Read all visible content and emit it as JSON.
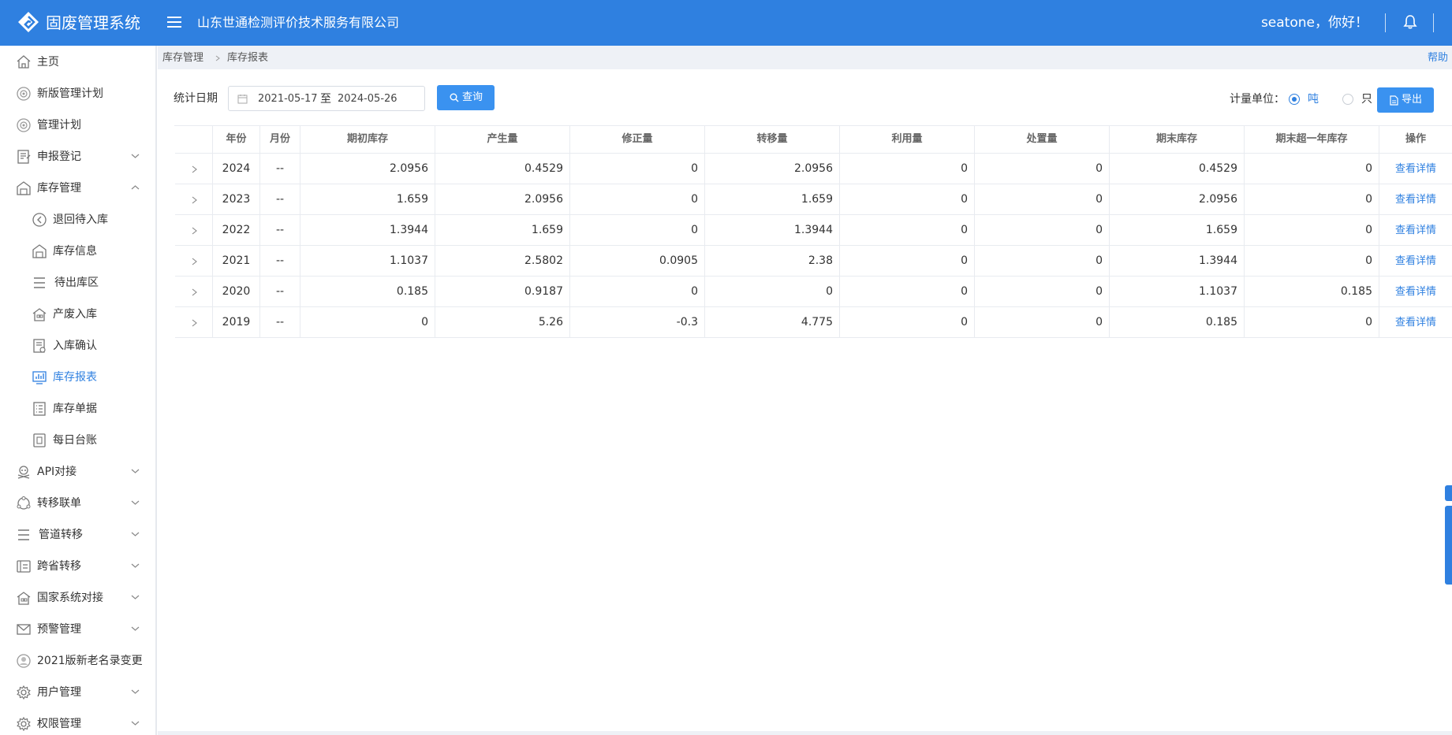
{
  "header": {
    "app_title": "固废管理系统",
    "company": "山东世通检测评价技术服务有限公司",
    "greeting": "seatone，你好！",
    "colors": {
      "primary": "#2f80e0"
    }
  },
  "sidebar": {
    "items": [
      {
        "label": "主页",
        "icon": "home-icon"
      },
      {
        "label": "新版管理计划",
        "icon": "plan-icon"
      },
      {
        "label": "管理计划",
        "icon": "plan-icon"
      },
      {
        "label": "申报登记",
        "icon": "form-icon",
        "expandable": true
      },
      {
        "label": "库存管理",
        "icon": "warehouse-icon",
        "expanded": true
      },
      {
        "label": "退回待入库",
        "icon": "return-icon",
        "sub": true
      },
      {
        "label": "库存信息",
        "icon": "warehouse-icon",
        "sub": true
      },
      {
        "label": "待出库区",
        "icon": "list-icon",
        "sub": true
      },
      {
        "label": "产废入库",
        "icon": "building-icon",
        "sub": true
      },
      {
        "label": "入库确认",
        "icon": "document-icon",
        "sub": true
      },
      {
        "label": "库存报表",
        "icon": "chart-icon",
        "sub": true,
        "active": true
      },
      {
        "label": "库存单据",
        "icon": "checklist-icon",
        "sub": true
      },
      {
        "label": "每日台账",
        "icon": "ledger-icon",
        "sub": true
      },
      {
        "label": "API对接",
        "icon": "api-icon",
        "expandable": true
      },
      {
        "label": "转移联单",
        "icon": "transfer-icon",
        "expandable": true
      },
      {
        "label": "管道转移",
        "icon": "list-icon",
        "expandable": true
      },
      {
        "label": "跨省转移",
        "icon": "card-icon",
        "expandable": true
      },
      {
        "label": "国家系统对接",
        "icon": "building-icon",
        "expandable": true
      },
      {
        "label": "预警管理",
        "icon": "mail-icon",
        "expandable": true
      },
      {
        "label": "2021版新老名录变更",
        "icon": "badge-icon"
      },
      {
        "label": "用户管理",
        "icon": "gear-icon",
        "expandable": true
      },
      {
        "label": "权限管理",
        "icon": "gear-icon",
        "expandable": true
      }
    ]
  },
  "breadcrumb": {
    "parent": "库存管理",
    "current": "库存报表",
    "help": "帮助"
  },
  "filter": {
    "label": "统计日期",
    "start": "2021-05-17",
    "to": "至",
    "end": "2024-05-26",
    "query_label": "查询",
    "unit_label": "计量单位：",
    "unit_options": [
      "吨",
      "只"
    ],
    "unit_selected": "吨",
    "export_label": "导出"
  },
  "table": {
    "headers": [
      "年份",
      "月份",
      "期初库存",
      "产生量",
      "修正量",
      "转移量",
      "利用量",
      "处置量",
      "期末库存",
      "期末超一年库存",
      "操作"
    ],
    "rows": [
      {
        "year": "2024",
        "month": "--",
        "opening": "2.0956",
        "generated": "0.4529",
        "corrected": "0",
        "transferred": "2.0956",
        "utilized": "0",
        "disposed": "0",
        "closing": "0.4529",
        "over_year": "0",
        "action": "查看详情"
      },
      {
        "year": "2023",
        "month": "--",
        "opening": "1.659",
        "generated": "2.0956",
        "corrected": "0",
        "transferred": "1.659",
        "utilized": "0",
        "disposed": "0",
        "closing": "2.0956",
        "over_year": "0",
        "action": "查看详情"
      },
      {
        "year": "2022",
        "month": "--",
        "opening": "1.3944",
        "generated": "1.659",
        "corrected": "0",
        "transferred": "1.3944",
        "utilized": "0",
        "disposed": "0",
        "closing": "1.659",
        "over_year": "0",
        "action": "查看详情"
      },
      {
        "year": "2021",
        "month": "--",
        "opening": "1.1037",
        "generated": "2.5802",
        "corrected": "0.0905",
        "transferred": "2.38",
        "utilized": "0",
        "disposed": "0",
        "closing": "1.3944",
        "over_year": "0",
        "action": "查看详情"
      },
      {
        "year": "2020",
        "month": "--",
        "opening": "0.185",
        "generated": "0.9187",
        "corrected": "0",
        "transferred": "0",
        "utilized": "0",
        "disposed": "0",
        "closing": "1.1037",
        "over_year": "0.185",
        "action": "查看详情"
      },
      {
        "year": "2019",
        "month": "--",
        "opening": "0",
        "generated": "5.26",
        "corrected": "-0.3",
        "transferred": "4.775",
        "utilized": "0",
        "disposed": "0",
        "closing": "0.185",
        "over_year": "0",
        "action": "查看详情"
      }
    ]
  }
}
